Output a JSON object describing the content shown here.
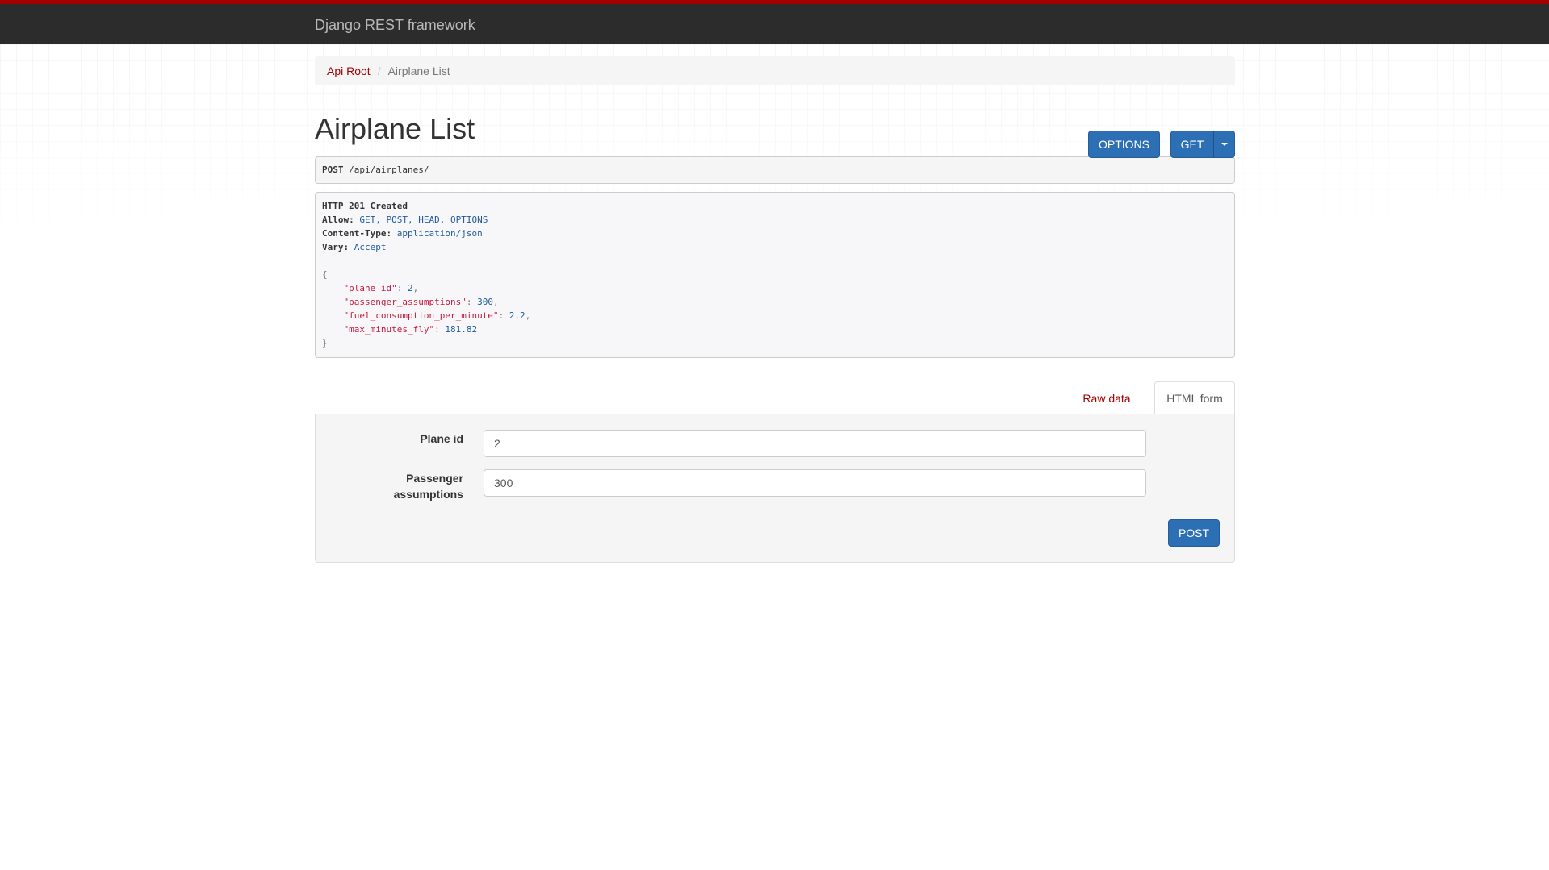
{
  "navbar": {
    "brand": "Django REST framework"
  },
  "breadcrumb": {
    "items": [
      "Api Root",
      "Airplane List"
    ],
    "separator": "/"
  },
  "page": {
    "title": "Airplane List"
  },
  "buttons": {
    "options": "OPTIONS",
    "get": "GET",
    "post": "POST"
  },
  "request": {
    "method": "POST",
    "path": "/api/airplanes/"
  },
  "response": {
    "status": "HTTP 201 Created",
    "headers": [
      {
        "key": "Allow",
        "value": "GET, POST, HEAD, OPTIONS"
      },
      {
        "key": "Content-Type",
        "value": "application/json"
      },
      {
        "key": "Vary",
        "value": "Accept"
      }
    ],
    "body": [
      {
        "key": "\"plane_id\"",
        "value": "2",
        "comma": ","
      },
      {
        "key": "\"passenger_assumptions\"",
        "value": "300",
        "comma": ","
      },
      {
        "key": "\"fuel_consumption_per_minute\"",
        "value": "2.2",
        "comma": ","
      },
      {
        "key": "\"max_minutes_fly\"",
        "value": "181.82",
        "comma": ""
      }
    ]
  },
  "tabs": {
    "raw": "Raw data",
    "html": "HTML form",
    "active": "HTML form"
  },
  "form": {
    "fields": [
      {
        "label": "Plane id",
        "value": "2"
      },
      {
        "label": "Passenger assumptions",
        "value": "300"
      }
    ]
  },
  "colors": {
    "brand_red": "#a30000",
    "primary_blue": "#2c6fb4",
    "navbar": "#2c2c2c"
  }
}
